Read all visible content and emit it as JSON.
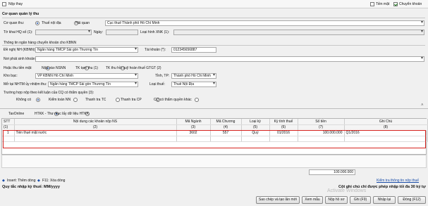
{
  "topbar": {
    "nop_thay": "Nộp thay",
    "tien_mat": "Tiền mặt",
    "chuyen_khoan": "Chuyển khoản"
  },
  "cqql": {
    "title": "Cơ quan quản lý thu",
    "co_quan_thu_label": "Cơ quan thu:",
    "opt_noi_dia": "Thuế nội địa",
    "opt_hai_quan": "Hải quan",
    "co_quan_value": "Cục thuế Thành phố Hồ Chí Minh",
    "to_khai_label": "Tờ khai HQ số (1):",
    "ngay_label": "Ngày:",
    "loai_hinh_label": "Loại hình XNK (1):"
  },
  "kbnn": {
    "title": "Thông tin ngân hàng chuyển khoản cho KBNN",
    "de_nghi_label": "Đề nghị NH (KBNN):",
    "de_nghi_value": "Ngân hàng TMCP Sài gòn Thương Tín",
    "tai_khoan_label": "Tài khoản (*):",
    "tai_khoan_value": "012345656887",
    "noi_phat_sinh_label": "Nơi phát sinh khoản thu:",
    "noptien_label": "Hoặc thu tiền mặt:",
    "opt_nop_vao": "Nộp vào NSNN",
    "opt_tk_tam_thu": "TK tạm thu (1)",
    "opt_tk_thu_hoi": "TK thu hồi quỹ hoàn thuế GTGT (2)",
    "kho_bac_label": "Kho bạc:",
    "kho_bac_value": "VP KBNN Hồ Chí Minh",
    "tinh_tp_label": "Tỉnh, TP:",
    "tinh_tp_value": "Thành phố Hồ Chí Minh",
    "mo_tai_label": "Mở tại NHTM ủy nhiệm thu:",
    "mo_tai_value": "Ngân hàng TMCP Sài gòn Thương Tín",
    "loai_thue_label": "Loại thuế:",
    "loai_thue_value": "Thuế Nội Địa",
    "truong_hop_label": "Trường hợp nộp theo kết luận của CQ có thẩm quyền (3):",
    "opt_khong_co": "Không có",
    "opt_kiem_toan": "Kiểm toán NN",
    "opt_thanh_tra_tc": "Thanh tra TC",
    "opt_thanh_tra_cp": "Thanh tra CP",
    "opt_cq_khac": "CQ có thẩm quyền khác"
  },
  "tabs": {
    "tax_online": "TaxOnline",
    "htkk": "HTKK - Thư mục lấy dữ liệu HTKK"
  },
  "grid": {
    "headers": [
      "STT",
      "Nội dung các khoản nộp NS",
      "Mã Ngành",
      "Mã Chương",
      "Loại kỳ",
      "Kỳ tính thuế",
      "Số tiền",
      "Ghi Chú"
    ],
    "numbers": [
      "(1)",
      "(2)",
      "(3)",
      "(4)",
      "(5)",
      "(6)",
      "(7)",
      "(8)"
    ],
    "rows": [
      [
        "1",
        "Tiền thuế mặt nước",
        "3602",
        "557",
        "Quý",
        "01/2016",
        "100.000.000",
        "Q1/2016"
      ]
    ],
    "total": "100.000.000"
  },
  "footer": {
    "insert_hint": "Insert: Thêm dòng",
    "f11_hint": "F11: Xóa dòng",
    "kiem_tra_link": "Kiểm tra thông tin nộp thuế",
    "quy_tac": "Quy tắc nhập kỳ thuế: MM/yyyy",
    "cot_ghi_chu": "Cột ghi chú chỉ được phép nhập tối đa 30 ký tự",
    "watermark": "Activate Windows"
  },
  "buttons": {
    "sao_chep": "Sao chép và tạo lần mới",
    "xem_mau": "Xem mẫu",
    "nop_ho_so": "Nộp hồ sơ",
    "ghi": "Ghi (F9)",
    "nhap_lai": "Nhập lại",
    "dong": "Đóng (F12)"
  },
  "colors": {
    "highlight_border": "#d6231e",
    "accent": "#1a4da8"
  }
}
